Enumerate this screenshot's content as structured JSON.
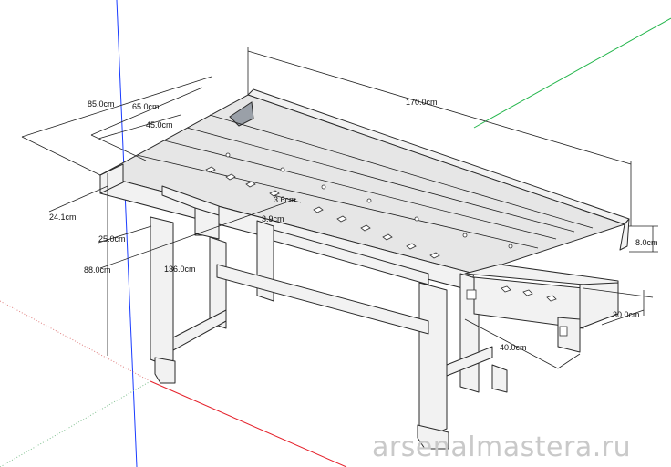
{
  "dimensions": {
    "d_170": "170.0cm",
    "d_85": "85.0cm",
    "d_65": "65.0cm",
    "d_45": "45.0cm",
    "d_24": "24.1cm",
    "d_25": "25.0cm",
    "d_88": "88.0cm",
    "d_136": "136.0cm",
    "d_3a": "3.6cm",
    "d_3b": "3.9cm",
    "d_8": "8.0cm",
    "d_30": "30.0cm",
    "d_40": "40.0cm"
  },
  "watermark": "arsenalmastera.ru",
  "colors": {
    "axis_blue": "#1a3cff",
    "axis_green": "#22b54a",
    "axis_red": "#e5202a"
  }
}
